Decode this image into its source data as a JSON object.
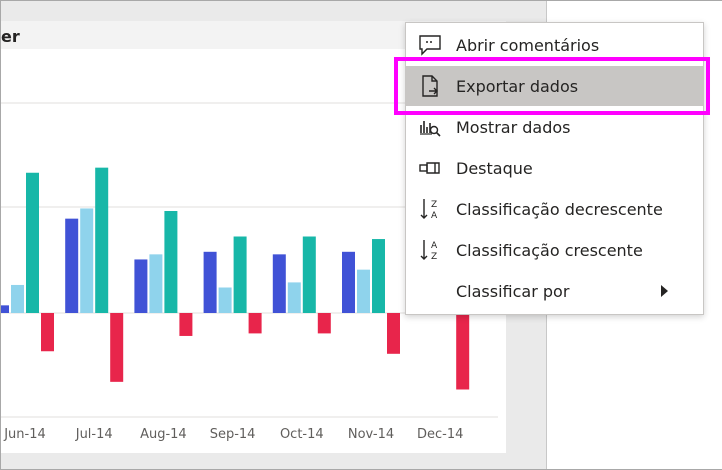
{
  "visual": {
    "title_fragment": "er"
  },
  "chart_data": {
    "type": "bar",
    "categories": [
      "Jun-14",
      "Jul-14",
      "Aug-14",
      "Sep-14",
      "Oct-14",
      "Nov-14",
      "Dec-14"
    ],
    "series": [
      {
        "color": "#4052d6",
        "values": [
          3,
          37,
          21,
          24,
          23,
          24,
          null
        ]
      },
      {
        "color": "#8fd3ec",
        "values": [
          11,
          41,
          23,
          10,
          12,
          17,
          null
        ]
      },
      {
        "color": "#17b7a8",
        "values": [
          55,
          57,
          40,
          30,
          30,
          29,
          null
        ]
      },
      {
        "color": "#e8254b",
        "values": [
          -15,
          -27,
          -9,
          -8,
          -8,
          -16,
          -30
        ]
      }
    ]
  },
  "menu": {
    "items": [
      {
        "label": "Abrir comentários",
        "icon": "comment-icon"
      },
      {
        "label": "Exportar dados",
        "icon": "export-icon",
        "selected": true
      },
      {
        "label": "Mostrar dados",
        "icon": "show-data-icon"
      },
      {
        "label": "Destaque",
        "icon": "spotlight-icon"
      },
      {
        "label": "Classificação decrescente",
        "icon": "sort-desc-icon"
      },
      {
        "label": "Classificação crescente",
        "icon": "sort-asc-icon"
      },
      {
        "label": "Classificar por",
        "icon": "chevron-right-icon"
      }
    ]
  },
  "colors": {
    "highlight": "#ff00ff",
    "selected_bg": "#c8c6c4"
  }
}
